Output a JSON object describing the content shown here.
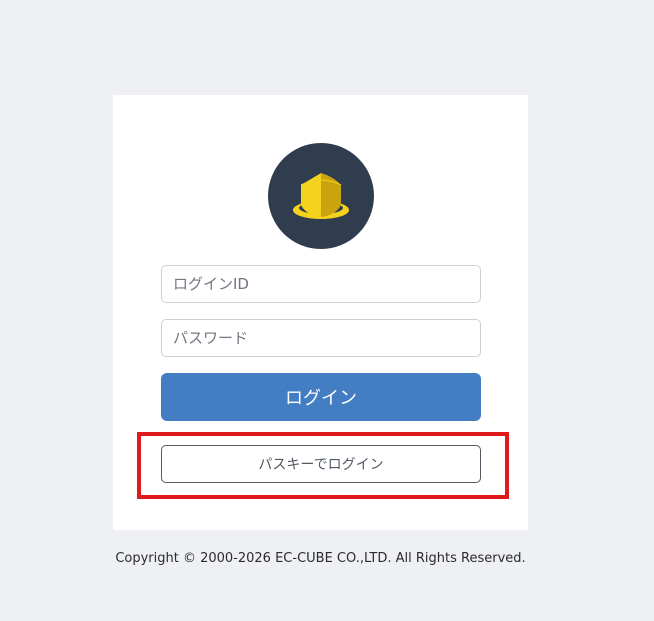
{
  "login": {
    "logo_icon": "ec-cube-hat-icon",
    "login_id_placeholder": "ログインID",
    "password_placeholder": "パスワード",
    "login_button_label": "ログイン",
    "passkey_button_label": "パスキーでログイン"
  },
  "footer": {
    "copyright": "Copyright © 2000-2026 EC-CUBE CO.,LTD. All Rights Reserved."
  },
  "colors": {
    "page_background": "#eef0f4",
    "logo_background": "#2f3d4f",
    "logo_yellow": "#f5d21e",
    "primary_button": "#437ec4",
    "highlight_border": "#e0191d"
  }
}
